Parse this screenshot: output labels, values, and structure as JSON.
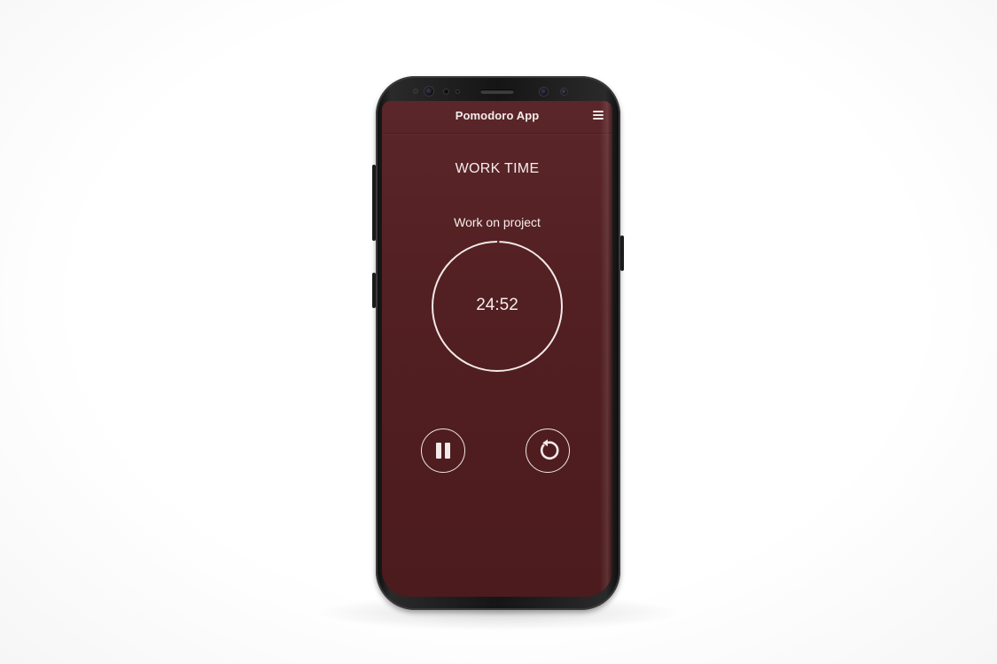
{
  "app": {
    "title": "Pomodoro App"
  },
  "header": {
    "menu_icon": "hamburger-menu-icon"
  },
  "session": {
    "mode": "WORK TIME",
    "task": "Work on project",
    "time_remaining": "24:52",
    "progress": 0.0053
  },
  "controls": {
    "pause_icon": "pause-icon",
    "reset_icon": "restart-icon"
  },
  "colors": {
    "background": "#5b2629",
    "foreground": "#f5eded"
  }
}
